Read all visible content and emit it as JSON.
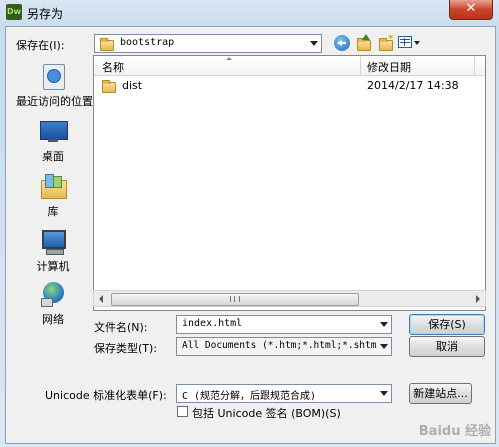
{
  "window": {
    "title": "另存为",
    "app_icon": "Dw",
    "close_label": "✕"
  },
  "toolbar": {
    "save_in_label": "保存在(I):",
    "current_folder": "bootstrap",
    "icons": [
      "back-icon",
      "up-folder-icon",
      "new-folder-icon",
      "view-menu-icon"
    ]
  },
  "places": [
    {
      "label": "最近访问的位置",
      "icon": "recent-places-icon"
    },
    {
      "label": "桌面",
      "icon": "desktop-icon"
    },
    {
      "label": "库",
      "icon": "libraries-icon"
    },
    {
      "label": "计算机",
      "icon": "computer-icon"
    },
    {
      "label": "网络",
      "icon": "network-icon"
    }
  ],
  "file_list": {
    "columns": [
      "名称",
      "修改日期"
    ],
    "rows": [
      {
        "name": "dist",
        "modified": "2014/2/17 14:38",
        "icon": "folder-icon"
      }
    ]
  },
  "form": {
    "filename_label": "文件名(N):",
    "filename_value": "index.html",
    "filetype_label": "保存类型(T):",
    "filetype_value": "All Documents (*.htm;*.html;*.shtm;*.",
    "unicode_label": "Unicode 标准化表单(F):",
    "unicode_value": "C (规范分解，后跟规范合成)",
    "bom_label": "包括 Unicode 签名 (BOM)(S)",
    "bom_checked": false
  },
  "buttons": {
    "save": "保存(S)",
    "cancel": "取消",
    "new_site": "新建站点..."
  },
  "watermark": "Baidu 经验"
}
